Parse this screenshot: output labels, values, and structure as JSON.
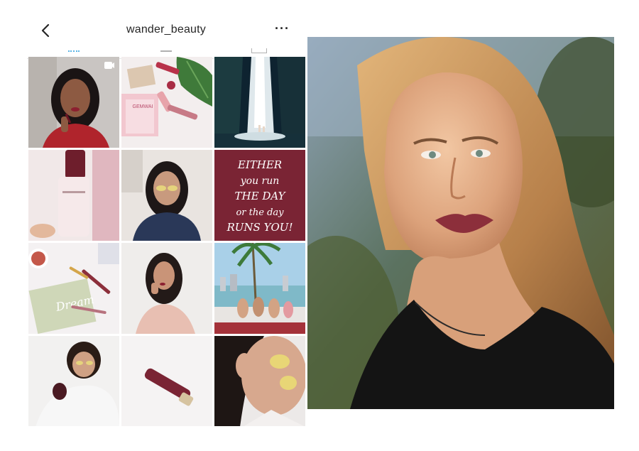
{
  "header": {
    "username": "wander_beauty",
    "back_icon": "chevron-left-icon",
    "more_label": "···"
  },
  "grid": {
    "quote_tile": {
      "lines": [
        "EITHER",
        "you run",
        "THE DAY",
        "or the day",
        "RUNS YOU!"
      ]
    },
    "gloss_tile_text": "GEMWAI",
    "notebook_text": "Dream"
  },
  "colors": {
    "brand_burgundy": "#7a2434",
    "lip": "#8c2f3b",
    "background": "#ffffff"
  }
}
